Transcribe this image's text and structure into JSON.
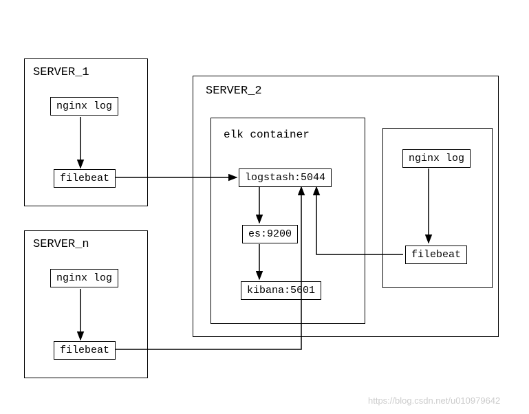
{
  "servers": {
    "server1": {
      "title": "SERVER_1",
      "nginx": "nginx log",
      "filebeat": "filebeat"
    },
    "serverN": {
      "title": "SERVER_n",
      "nginx": "nginx log",
      "filebeat": "filebeat"
    },
    "server2": {
      "title": "SERVER_2",
      "container": {
        "title": "elk container",
        "logstash": "logstash:5044",
        "es": "es:9200",
        "kibana": "kibana:5601"
      },
      "nginx": "nginx log",
      "filebeat": "filebeat"
    }
  },
  "watermark": "https://blog.csdn.net/u010979642"
}
